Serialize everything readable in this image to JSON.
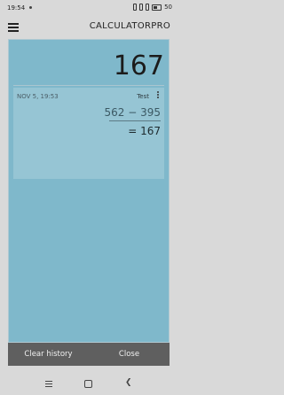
{
  "status": {
    "time": "19:54",
    "battery_percent": "50",
    "signal_icons": [
      "sim-icon",
      "wifi-icon",
      "battery-icon"
    ]
  },
  "app": {
    "title": "CALCULATORPRO"
  },
  "display": {
    "value": "167"
  },
  "history": {
    "items": [
      {
        "date": "NOV 5, 19:53",
        "tag": "Test",
        "expression": "562 − 395",
        "result": "= 167"
      }
    ]
  },
  "actions": {
    "clear_label": "Clear history",
    "close_label": "Close"
  },
  "colors": {
    "panel": "#7fb8cb",
    "card": "#96c5d4",
    "bottom_bar": "#5f5f5f",
    "background": "#d9d9d9"
  }
}
